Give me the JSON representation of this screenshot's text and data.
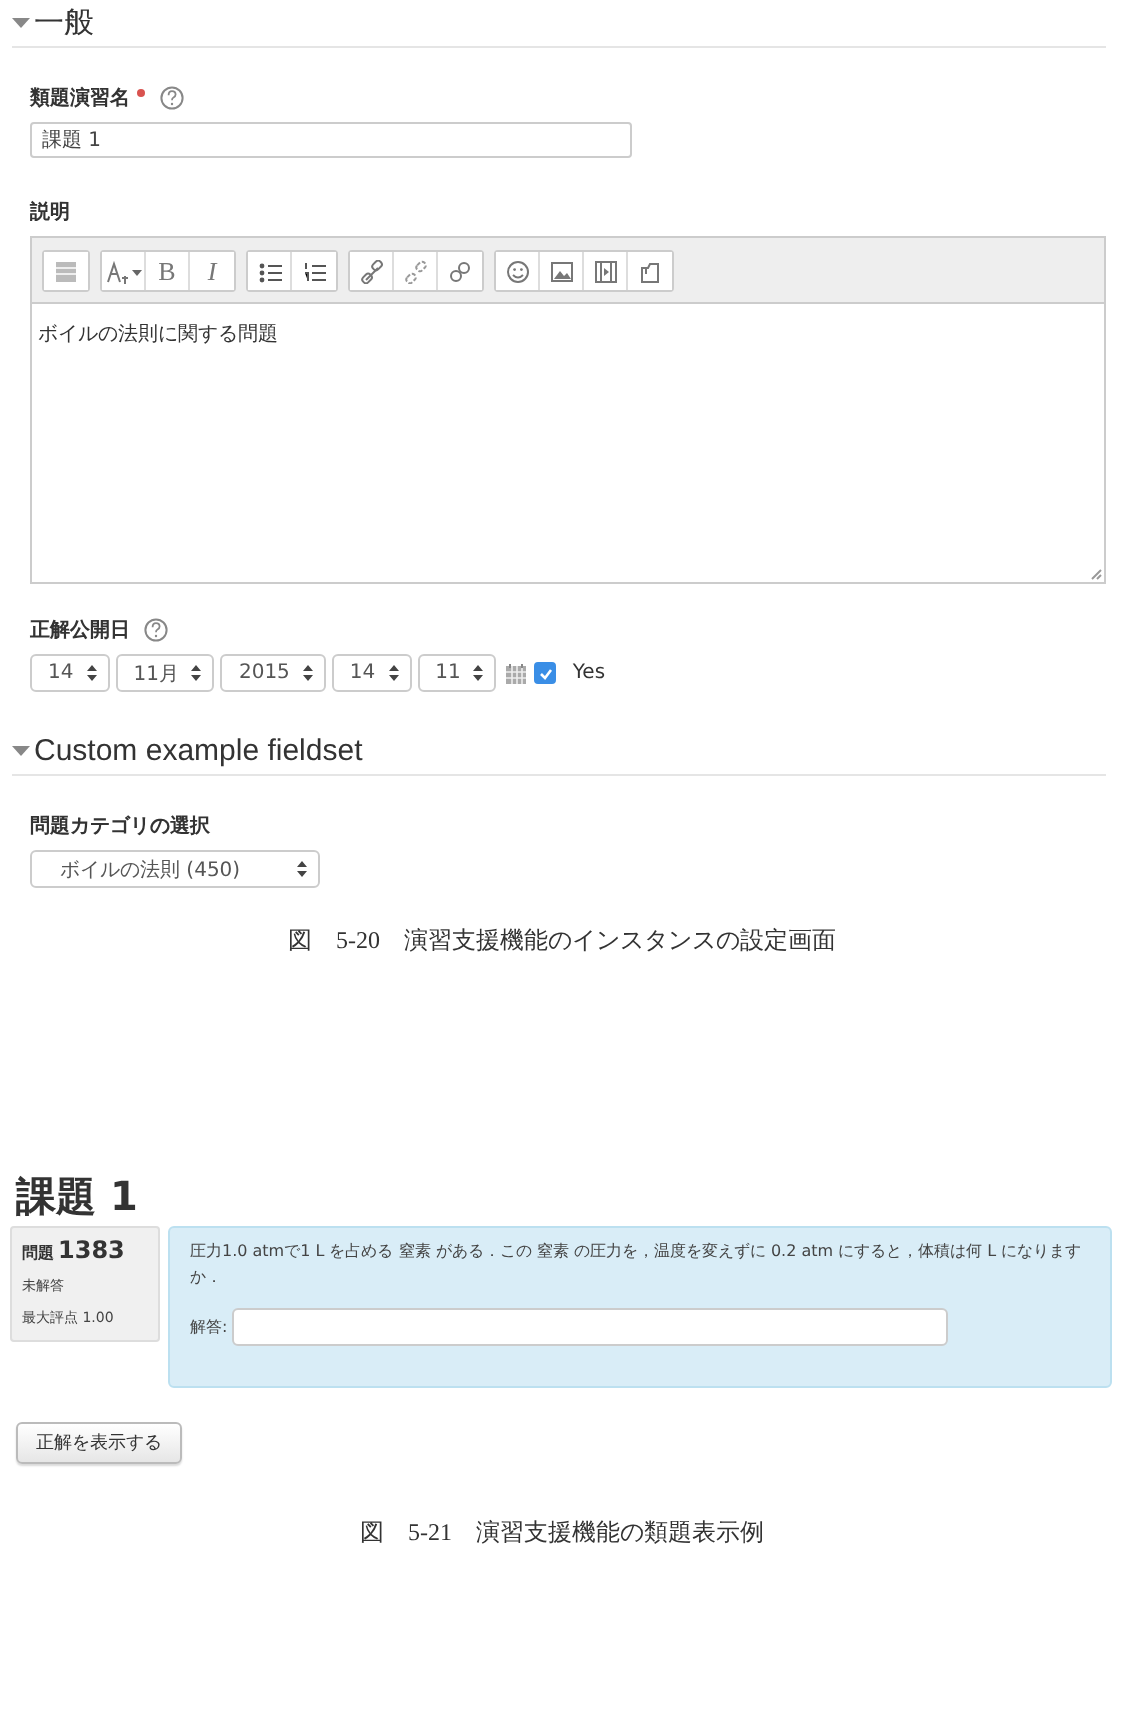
{
  "settings_form": {
    "sections": [
      {
        "title": "一般",
        "expanded": true,
        "fields": [
          {
            "kind": "text",
            "label": "類題演習名",
            "required": true,
            "help": true,
            "value": "課題 1"
          },
          {
            "kind": "editor",
            "label": "説明",
            "required": false,
            "help": false,
            "toolbar": [
              [
                {
                  "kind": "html"
                }
              ],
              [
                {
                  "kind": "format"
                },
                {
                  "kind": "bold",
                  "label": "B"
                },
                {
                  "kind": "italic",
                  "label": "I"
                }
              ],
              [
                {
                  "kind": "bullets"
                },
                {
                  "kind": "numbers"
                }
              ],
              [
                {
                  "kind": "link"
                },
                {
                  "kind": "unlink"
                },
                {
                  "kind": "anchor"
                }
              ],
              [
                {
                  "kind": "emoji"
                },
                {
                  "kind": "image"
                },
                {
                  "kind": "media"
                },
                {
                  "kind": "files"
                }
              ]
            ],
            "value": "ボイルの法則に関する問題"
          },
          {
            "kind": "date",
            "label": "正解公開日",
            "required": false,
            "help": true,
            "selects": [
              "14",
              "11月",
              "2015",
              "14",
              "11"
            ],
            "enabled": true,
            "enable_label": "Yes"
          }
        ]
      },
      {
        "title": "Custom example fieldset",
        "expanded": true,
        "fields": [
          {
            "kind": "select",
            "label": "問題カテゴリの選択",
            "required": false,
            "help": false,
            "value": "ボイルの法則 (450)"
          }
        ]
      }
    ]
  },
  "caption_1": "図　5-20　演習支援機能のインスタンスの設定画面",
  "question_view": {
    "title": "課題 1",
    "info": {
      "label": "問題",
      "number": "1383",
      "state": "未解答",
      "mark": "最大評点 1.00"
    },
    "text": "圧力1.0 atmで1 L を占める 窒素 がある．この 窒素 の圧力を，温度を変えずに 0.2 atm にすると，体積は何 L になりますか．",
    "answer_label": "解答:",
    "button": "正解を表示する"
  },
  "caption_2": "図　5-21　演習支援機能の類題表示例"
}
